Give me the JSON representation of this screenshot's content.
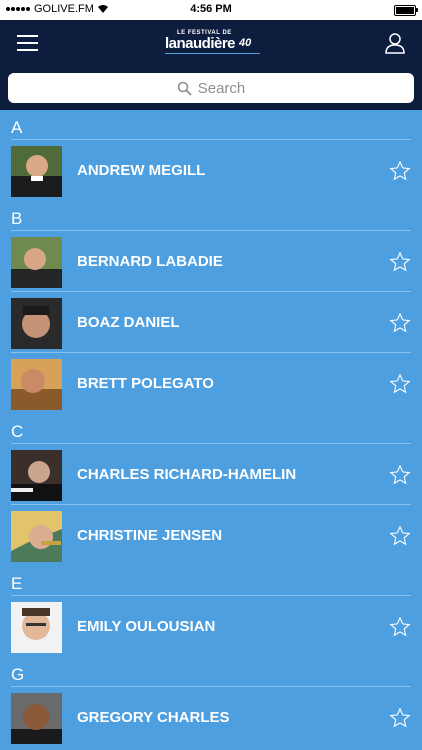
{
  "status_bar": {
    "carrier": "GOLIVE.FM",
    "time": "4:56 PM"
  },
  "header": {
    "logo_small": "LE FESTIVAL DE",
    "logo_main": "lanaudière",
    "logo_badge": "40"
  },
  "search": {
    "placeholder": "Search"
  },
  "colors": {
    "background": "#4e9fdf",
    "header": "#0c1d3d"
  },
  "sections": [
    {
      "letter": "A",
      "artists": [
        {
          "name": "ANDREW MEGILL"
        }
      ]
    },
    {
      "letter": "B",
      "artists": [
        {
          "name": "BERNARD LABADIE"
        },
        {
          "name": "BOAZ DANIEL"
        },
        {
          "name": "BRETT POLEGATO"
        }
      ]
    },
    {
      "letter": "C",
      "artists": [
        {
          "name": "CHARLES RICHARD-HAMELIN"
        },
        {
          "name": "CHRISTINE JENSEN"
        }
      ]
    },
    {
      "letter": "E",
      "artists": [
        {
          "name": "EMILY OULOUSIAN"
        }
      ]
    },
    {
      "letter": "G",
      "artists": [
        {
          "name": "GREGORY CHARLES"
        }
      ]
    }
  ]
}
